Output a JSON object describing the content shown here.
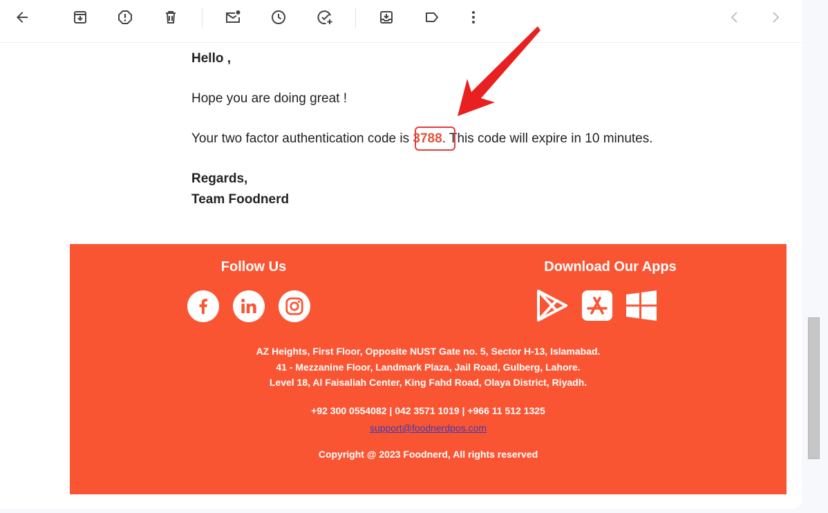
{
  "toolbar": {
    "icons": [
      "back-arrow-icon",
      "archive-icon",
      "report-spam-icon",
      "delete-icon",
      "mark-unread-icon",
      "snooze-icon",
      "add-to-tasks-icon",
      "move-to-icon",
      "label-icon",
      "more-options-icon",
      "newer-icon",
      "older-icon"
    ]
  },
  "email": {
    "greeting": "Hello ,",
    "hope": "Hope you are doing great !",
    "code_prefix": "Your two factor authentication code is ",
    "code": "3788",
    "code_suffix": ". This code will expire in 10 minutes.",
    "regards": "Regards,",
    "team": "Team Foodnerd"
  },
  "annotation": {
    "arrow_color": "#e8201f",
    "highlight_color": "#e23b3b"
  },
  "footer": {
    "background": "#fa5533",
    "follow_heading": "Follow Us",
    "apps_heading": "Download Our Apps",
    "social": [
      "facebook-icon",
      "linkedin-icon",
      "instagram-icon"
    ],
    "apps": [
      "google-play-icon",
      "app-store-icon",
      "windows-icon"
    ],
    "addresses": [
      "AZ Heights, First Floor, Opposite NUST Gate no. 5, Sector H-13, Islamabad.",
      "41 - Mezzanine Floor, Landmark Plaza, Jail Road, Gulberg, Lahore.",
      "Level 18, Al Faisaliah Center, King Fahd Road, Olaya District, Riyadh."
    ],
    "phones": "+92 300 0554082 | 042 3571 1019 | +966 11 512 1325",
    "support_email": "support@foodnerdpos.com",
    "copyright": "Copyright @ 2023 Foodnerd, All rights reserved"
  }
}
